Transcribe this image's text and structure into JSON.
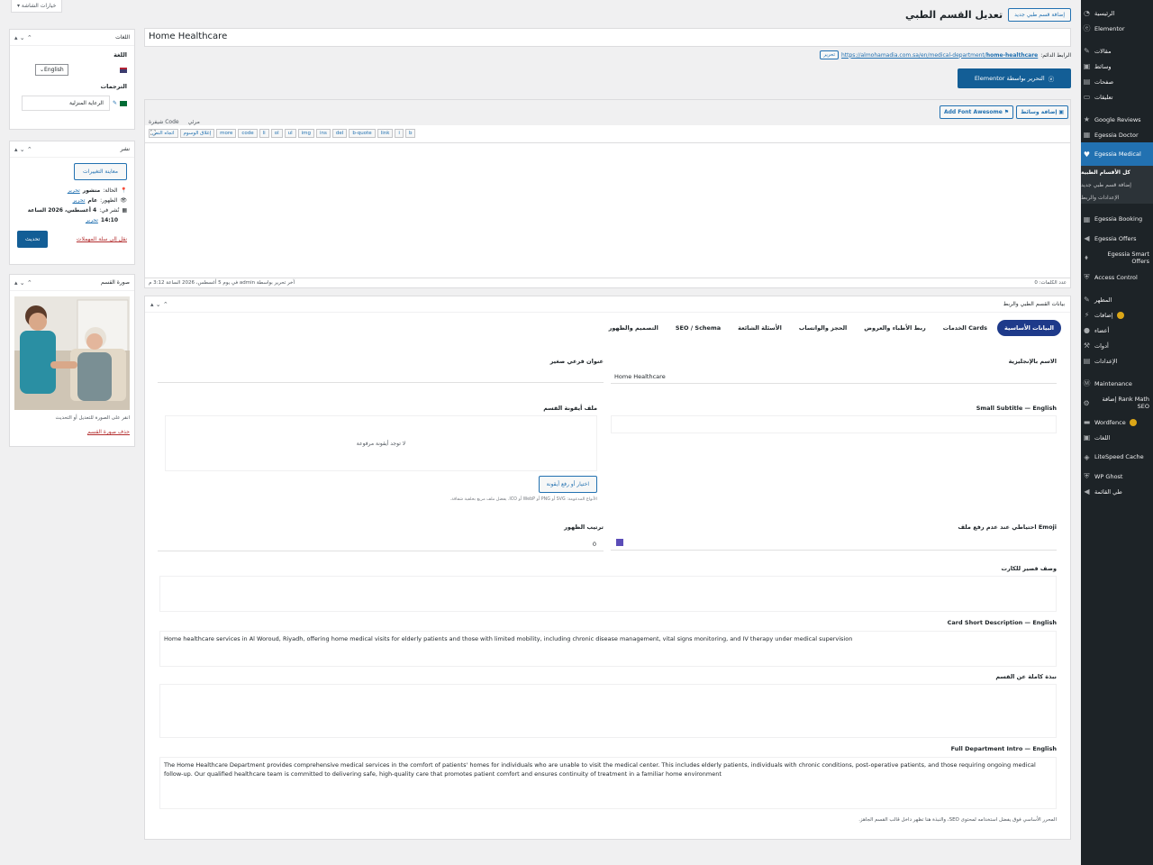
{
  "screen_options": "خيارات الشاشة ▾",
  "sidebar": {
    "items": [
      {
        "label": "الرئيسية",
        "icon": "dashboard-icon"
      },
      {
        "label": "Elementor",
        "icon": "elementor-icon"
      },
      {
        "label": "مقالات",
        "icon": "pin-icon"
      },
      {
        "label": "وسائط",
        "icon": "media-icon"
      },
      {
        "label": "صفحات",
        "icon": "pages-icon"
      },
      {
        "label": "تعليقات",
        "icon": "comments-icon"
      },
      {
        "label": "Google Reviews",
        "icon": "star-icon"
      },
      {
        "label": "Egessia Doctor",
        "icon": "doctor-icon"
      },
      {
        "label": "Egessia Medical",
        "icon": "heart-icon"
      }
    ],
    "submenu": [
      "كل الأقسام الطبية",
      "إضافة قسم طبي جديد",
      "الإعدادات والربط"
    ],
    "items2": [
      {
        "label": "Egessia Booking",
        "icon": "calendar-icon"
      },
      {
        "label": "Egessia Offers",
        "icon": "megaphone-icon"
      },
      {
        "label": "Egessia Smart Offers",
        "icon": "tag-icon"
      },
      {
        "label": "Access Control",
        "icon": "shield-icon"
      },
      {
        "label": "المظهر",
        "icon": "brush-icon"
      },
      {
        "label": "إضافات",
        "icon": "plugin-icon",
        "badge": "orange"
      },
      {
        "label": "أعضاء",
        "icon": "users-icon"
      },
      {
        "label": "أدوات",
        "icon": "tools-icon"
      },
      {
        "label": "الإعدادات",
        "icon": "settings-icon"
      },
      {
        "label": "Maintenance",
        "icon": "maintenance-icon"
      },
      {
        "label": "Rank Math إضافة SEO",
        "icon": "rankmath-icon"
      },
      {
        "label": "Wordfence",
        "icon": "wordfence-icon",
        "badge": "orange"
      },
      {
        "label": "اللغات",
        "icon": "languages-icon"
      },
      {
        "label": "LiteSpeed Cache",
        "icon": "litespeed-icon"
      },
      {
        "label": "WP Ghost",
        "icon": "ghost-icon"
      },
      {
        "label": "طي القائمة",
        "icon": "collapse-icon"
      }
    ]
  },
  "header": {
    "title": "تعديل القسم الطبي",
    "add_new": "إضافة قسم طبي جديد",
    "post_title": "Home Healthcare",
    "permalink_label": "الرابط الدائم:",
    "permalink_url_base": "https://almohamadia.com.sa/en/medical-department/",
    "permalink_slug": "home-healthcare",
    "permalink_edit": "تحرير",
    "elementor_btn": "التحرير بواسطة Elementor"
  },
  "editor": {
    "add_media": "إضافة وسائط",
    "add_fa": "Add Font Awesome",
    "tab_visual": "مرئي",
    "tab_code": "Code شيفرة",
    "qt_buttons": [
      "b",
      "i",
      "link",
      "b-quote",
      "del",
      "ins",
      "img",
      "ul",
      "ol",
      "li",
      "code",
      "more",
      "إغلاق الوسوم",
      "اتجاه النص"
    ],
    "word_count": "عدد الكلمات: 0",
    "last_edit": "آخر تحرير بواسطة admin في يوم 5 أغسطس، 2026 الساعة 3:12 م"
  },
  "metabox": {
    "title": "بيانات القسم الطبي والربط",
    "tabs": [
      "البيانات الأساسية",
      "Cards الخدمات",
      "ربط الأطباء والعروض",
      "الحجز والواتساب",
      "الأسئلة الشائعة",
      "SEO / Schema",
      "التصميم والظهور"
    ],
    "fields": {
      "name_en_label": "الاسم بالإنجليزية",
      "name_en_value": "Home Healthcare",
      "short_title_label": "عنوان فرعي صغير",
      "small_subtitle_label": "Small Subtitle — English",
      "icon_label": "ملف أيقونة القسم",
      "icon_empty": "لا توجد أيقونة مرفوعة",
      "icon_btn": "اختيار أو رفع أيقونة",
      "icon_hint": "الأنواع المدعومة: SVG أو PNG أو WebP أو ICO. يفضل ملف مربع بخلفية شفافة.",
      "emoji_label": "Emoji احتياطي عند عدم رفع ملف",
      "order_label": "ترتيب الظهور",
      "order_value": "0",
      "card_short_label": "وصف قصير للكارت",
      "card_short_en_label": "Card Short Description — English",
      "card_short_en_value": "Home healthcare services in Al Woroud, Riyadh, offering home medical visits for elderly patients and those with limited mobility, including chronic disease management, vital signs monitoring, and IV therapy under medical supervision",
      "full_intro_label": "نبذة كاملة عن القسم",
      "full_intro_en_label": "Full Department Intro — English",
      "full_intro_en_value": "The Home Healthcare Department provides comprehensive medical services in the comfort of patients' homes for individuals who are unable to visit the medical center. This includes elderly patients, individuals with chronic conditions, post-operative patients, and those requiring ongoing medical follow-up. Our qualified healthcare team is committed to delivering safe, high-quality care that promotes patient comfort and ensures continuity of treatment in a familiar home environment",
      "footer_note": "المحرر الأساسي فوق يفضل استخدامه لمحتوى SEO، والنبذة هنا تظهر داخل قالب القسم الجاهز."
    }
  },
  "panels": {
    "languages": {
      "title": "اللغات",
      "lang_label": "اللغة",
      "lang_value": "English",
      "translations_label": "الترجمات",
      "translation_value": "الرعاية المنزلية"
    },
    "publish": {
      "title": "نشر",
      "preview": "معاينة التغييرات",
      "status_label": "الحالة:",
      "status_value": "منشور",
      "visibility_label": "الظهور:",
      "visibility_value": "عام",
      "published_label": "نُشر في:",
      "published_value": "4 أغسطس، 2026 الساعة",
      "published_time": "14:10",
      "edit": "تحرير",
      "trash": "نقل إلى سلة المهملات",
      "update": "تحديث"
    },
    "image": {
      "title": "صورة القسم",
      "hint": "انقر على الصورة للتعديل أو التحديث",
      "remove": "حذف صورة القسم"
    }
  },
  "colors": {
    "accent": "#2271b1",
    "sidebar": "#1d2327",
    "active": "#2271b1",
    "tab_active": "#1e3a8a"
  }
}
